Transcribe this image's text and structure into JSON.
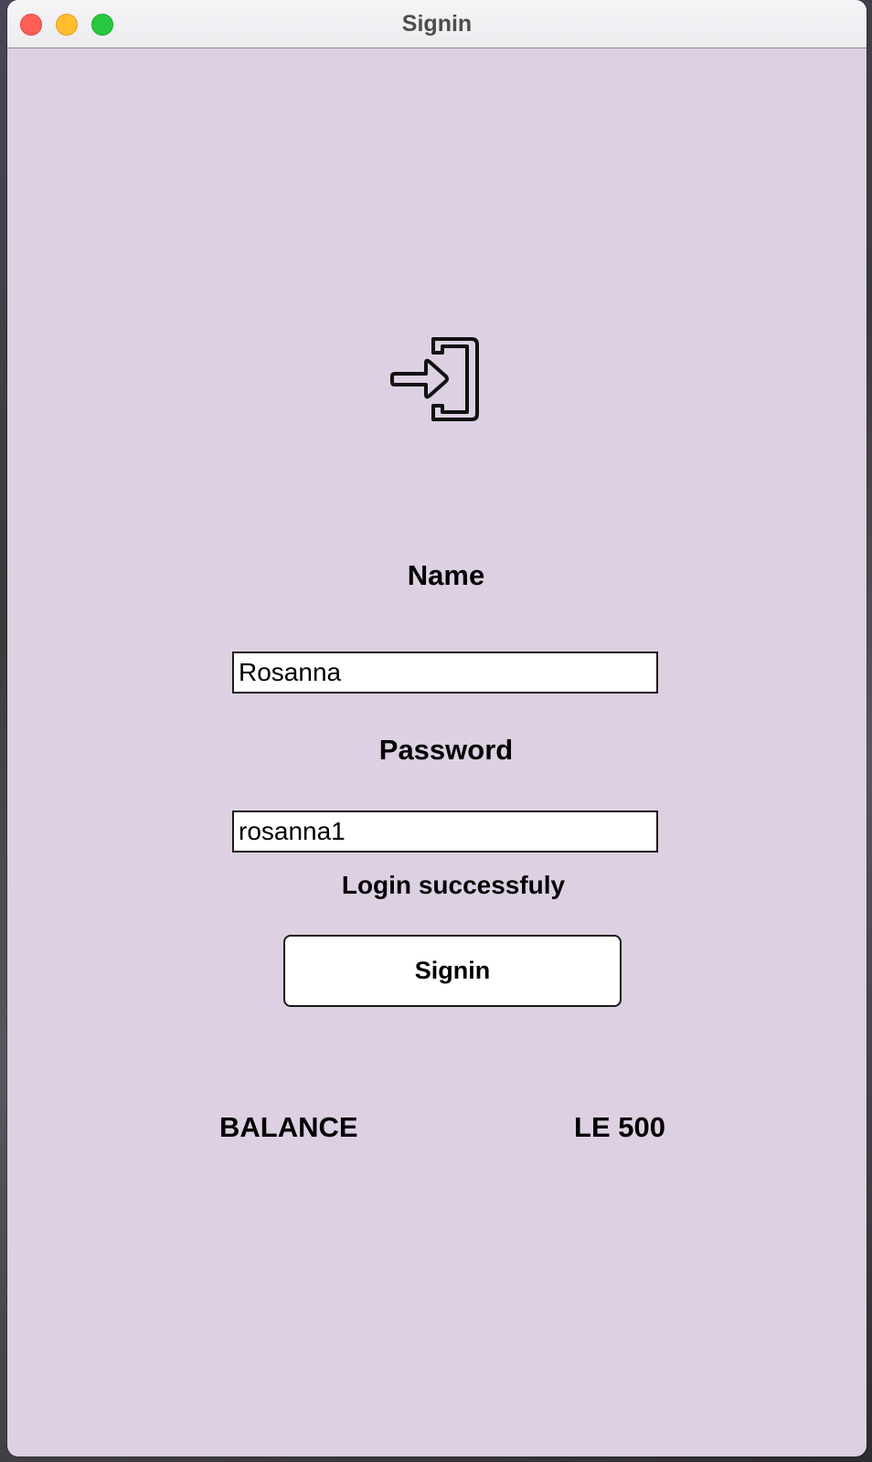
{
  "window": {
    "title": "Signin",
    "background_color": "#ddd0e2"
  },
  "titlebar": {
    "controls": [
      "close",
      "minimize",
      "zoom"
    ],
    "colors": {
      "close": "#fe5f57",
      "minimize": "#febc2e",
      "zoom": "#28c840"
    }
  },
  "header_icon": "sign-in-icon",
  "form": {
    "name_label": "Name",
    "name_value": "Rosanna",
    "password_label": "Password",
    "password_value": "rosanna1",
    "status_message": "Login successfuly",
    "signin_button_label": "Signin"
  },
  "balance": {
    "label": "BALANCE",
    "value": "LE 500"
  }
}
